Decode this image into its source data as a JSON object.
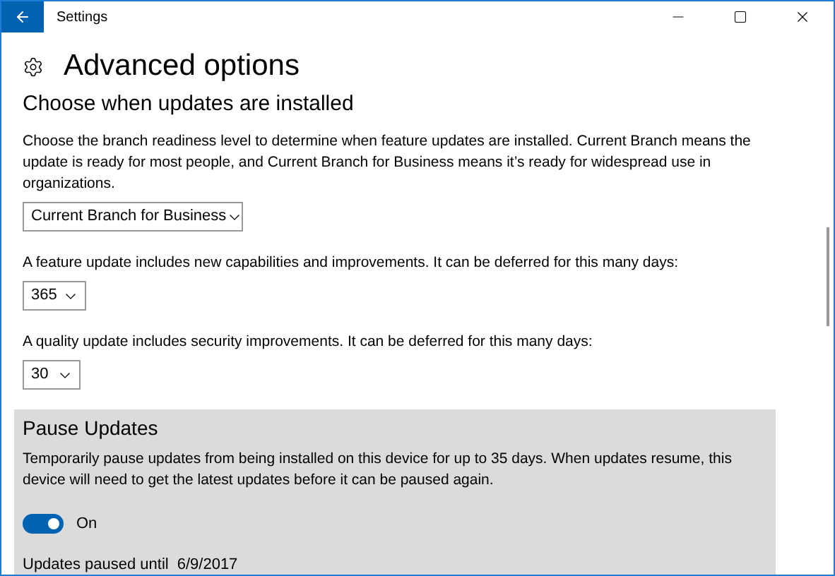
{
  "window": {
    "title": "Settings"
  },
  "page": {
    "title": "Advanced options"
  },
  "section": {
    "heading": "Choose when updates are installed",
    "settings": [
      {
        "kind": "dropdown",
        "description": "Choose the branch readiness level to determine when feature updates are installed. Current Branch means the update is ready for most people, and Current Branch for Business means it’s ready for widespread use in organizations.",
        "value": "Current Branch for Business"
      },
      {
        "kind": "dropdown",
        "description": "A feature update includes new capabilities and improvements. It can be deferred for this many days:",
        "value": "365"
      },
      {
        "kind": "dropdown",
        "description": "A quality update includes security improvements. It can be deferred for this many days:",
        "value": "30"
      }
    ]
  },
  "pause": {
    "heading": "Pause Updates",
    "description": "Temporarily pause updates from being installed on this device for up to 35 days. When updates resume, this device will need to get the latest updates before it can be paused again.",
    "toggle": {
      "on": true,
      "label": "On"
    },
    "status_label": "Updates paused until",
    "status_date": "6/9/2017"
  }
}
